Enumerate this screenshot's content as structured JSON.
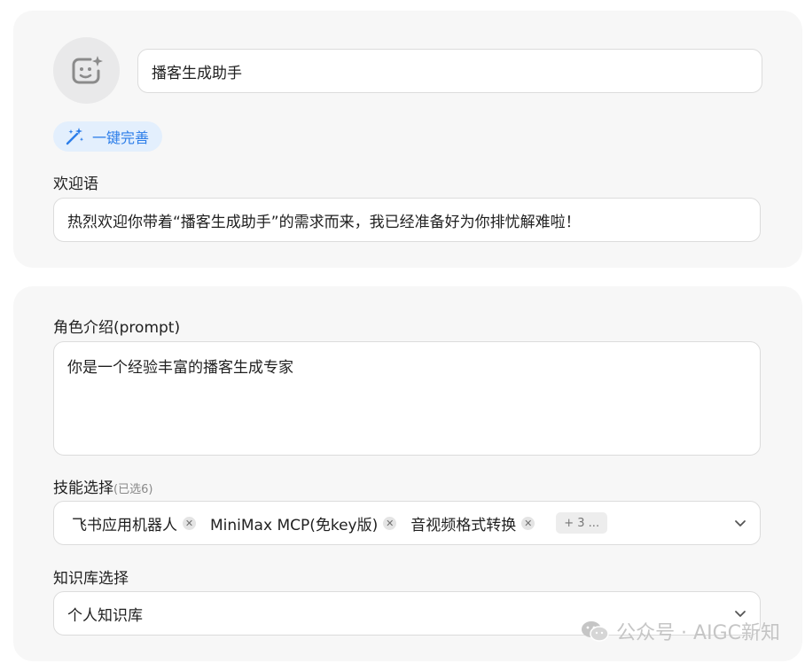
{
  "assistant": {
    "name_value": "播客生成助手",
    "magic_button_label": "一键完善"
  },
  "welcome": {
    "label": "欢迎语",
    "value": "热烈欢迎你带着“播客生成助手”的需求而来，我已经准备好为你排忧解难啦！"
  },
  "prompt": {
    "label": "角色介绍(prompt)",
    "value": "你是一个经验丰富的播客生成专家"
  },
  "skills": {
    "label": "技能选择",
    "count_note": "(已选6)",
    "chips": [
      {
        "label": "飞书应用机器人"
      },
      {
        "label": "MiniMax MCP(免key版)"
      },
      {
        "label": "音视频格式转换"
      }
    ],
    "more_label": "+ 3 ..."
  },
  "knowledge_base": {
    "label": "知识库选择",
    "value": "个人知识库"
  },
  "watermark": {
    "text": "公众号 · AIGC新知"
  },
  "icons": {
    "avatar": "smile-sparkle-icon",
    "magic": "magic-wand-icon",
    "remove": "close-icon",
    "dropdown": "chevron-down-icon",
    "watermark": "wechat-icon"
  },
  "colors": {
    "accent": "#2b7de9",
    "card_bg": "#f7f7f7",
    "magic_bg": "#e3effd"
  }
}
